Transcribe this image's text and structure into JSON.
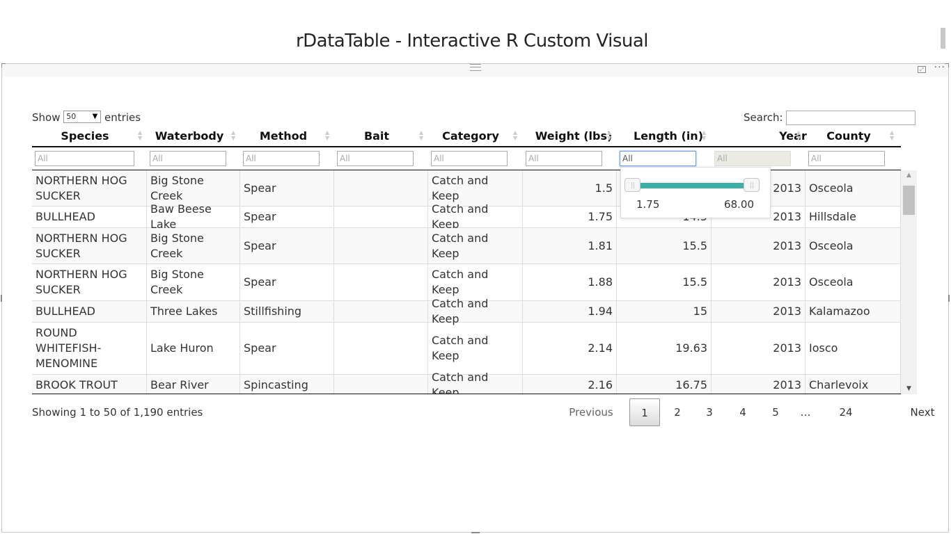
{
  "report": {
    "title": "rDataTable - Interactive R Custom Visual"
  },
  "visual_header": {
    "more_label": "···"
  },
  "datatable": {
    "show_label": "Show",
    "page_length": "50",
    "entries_label": "entries",
    "search_label": "Search:",
    "search_value": "",
    "columns": [
      "Species",
      "Waterbody",
      "Method",
      "Bait",
      "Category",
      "Weight (lbs)",
      "Length (in)",
      "Year",
      "County"
    ],
    "filter_placeholder": "All",
    "rows": [
      [
        "NORTHERN HOG SUCKER",
        "Big Stone Creek",
        "Spear",
        "",
        "Catch and Keep",
        "1.5",
        "",
        "2013",
        "Osceola"
      ],
      [
        "BULLHEAD",
        "Baw Beese Lake",
        "Spear",
        "",
        "Catch and Keep",
        "1.75",
        "14.5",
        "2013",
        "Hillsdale"
      ],
      [
        "NORTHERN HOG SUCKER",
        "Big Stone Creek",
        "Spear",
        "",
        "Catch and Keep",
        "1.81",
        "15.5",
        "2013",
        "Osceola"
      ],
      [
        "NORTHERN HOG SUCKER",
        "Big Stone Creek",
        "Spear",
        "",
        "Catch and Keep",
        "1.88",
        "15.5",
        "2013",
        "Osceola"
      ],
      [
        "BULLHEAD",
        "Three Lakes",
        "Stillfishing",
        "",
        "Catch and Keep",
        "1.94",
        "15",
        "2013",
        "Kalamazoo"
      ],
      [
        "ROUND WHITEFISH-MENOMINE",
        "Lake Huron",
        "Spear",
        "",
        "Catch and Keep",
        "2.14",
        "19.63",
        "2013",
        "Iosco"
      ],
      [
        "BROOK TROUT",
        "Bear River",
        "Spincasting",
        "",
        "Catch and Keep",
        "2.16",
        "16.75",
        "2013",
        "Charlevoix"
      ]
    ],
    "range_filter": {
      "min": "1.75",
      "max": "68.00"
    },
    "info": "Showing 1 to 50 of 1,190 entries",
    "pagination": {
      "previous": "Previous",
      "pages": [
        "1",
        "2",
        "3",
        "4",
        "5",
        "…",
        "24"
      ],
      "next": "Next",
      "current": "1"
    }
  }
}
